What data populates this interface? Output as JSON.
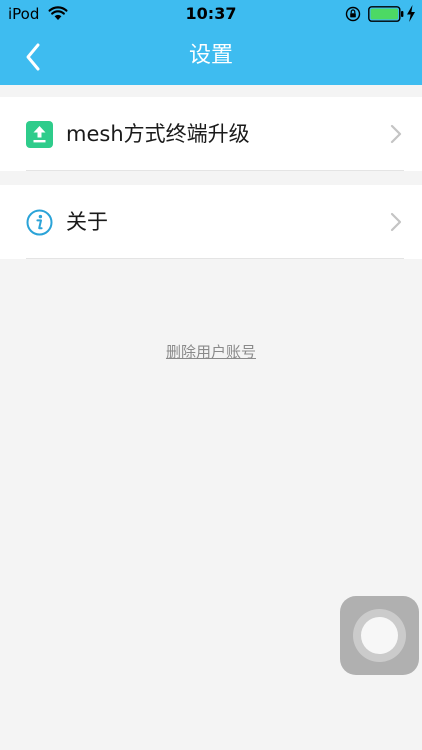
{
  "status_bar": {
    "carrier": "iPod",
    "time": "10:37"
  },
  "nav": {
    "title": "设置",
    "back_icon": "chevron-left-icon"
  },
  "settings": {
    "items": [
      {
        "label": "mesh方式终端升级",
        "icon": "upload-icon"
      },
      {
        "label": "关于",
        "icon": "info-icon"
      }
    ]
  },
  "delete_account_label": "删除用户账号",
  "colors": {
    "nav_background": "#3ebcf0",
    "upload_icon": "#2ecc8b",
    "info_icon": "#2aa3d8",
    "battery_fill": "#4cd964"
  }
}
